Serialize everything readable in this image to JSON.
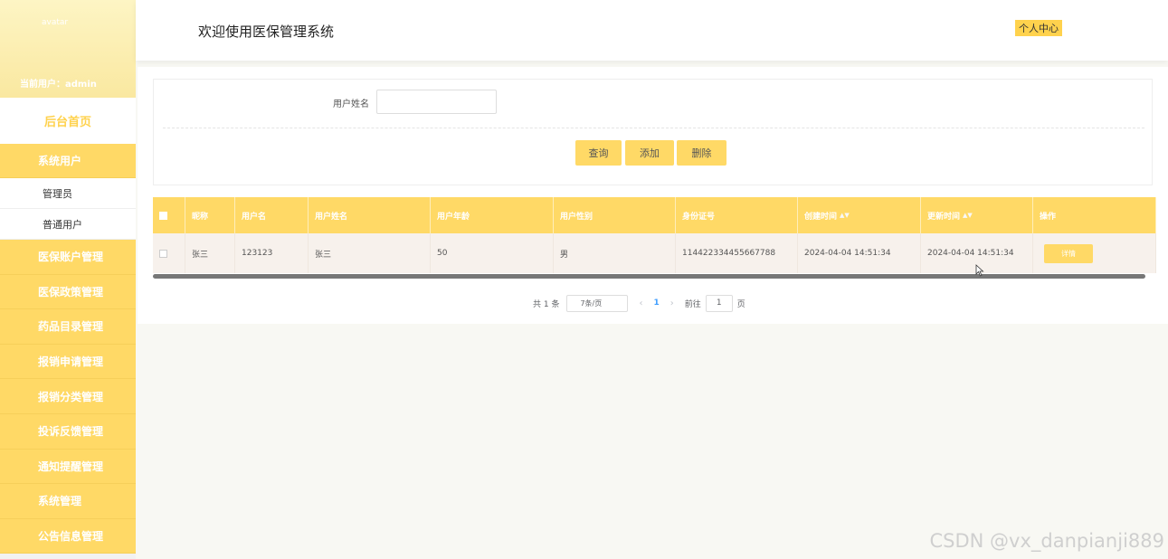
{
  "sidebar": {
    "avatar_alt": "avatar",
    "current_user": "当前用户：admin",
    "home": "后台首页",
    "items": [
      {
        "label": "系统用户"
      },
      {
        "label": "管理员",
        "sub": true
      },
      {
        "label": "普通用户",
        "sub": true
      },
      {
        "label": "医保账户管理"
      },
      {
        "label": "医保政策管理"
      },
      {
        "label": "药品目录管理"
      },
      {
        "label": "报销申请管理"
      },
      {
        "label": "报销分类管理"
      },
      {
        "label": "投诉反馈管理"
      },
      {
        "label": "通知提醒管理"
      },
      {
        "label": "系统管理"
      },
      {
        "label": "公告信息管理"
      }
    ]
  },
  "header": {
    "title": "欢迎使用医保管理系统",
    "personal_center": "个人中心"
  },
  "search": {
    "label": "用户姓名",
    "value": "",
    "query_btn": "查询",
    "add_btn": "添加",
    "delete_btn": "删除"
  },
  "table": {
    "columns": [
      "昵称",
      "用户名",
      "用户姓名",
      "用户年龄",
      "用户性别",
      "身份证号",
      "创建时间",
      "更新时间",
      "操作"
    ],
    "rows": [
      {
        "nickname": "张三",
        "username": "123123",
        "realname": "张三",
        "age": "50",
        "gender": "男",
        "id_card": "114422334455667788",
        "created": "2024-04-04 14:51:34",
        "updated": "2024-04-04 14:51:34",
        "action": "详情"
      }
    ]
  },
  "pagination": {
    "total": "共 1 条",
    "page_size": "7条/页",
    "current_page": "1",
    "goto_label": "前往",
    "goto_value": "1",
    "page_suffix": "页"
  },
  "watermark": "CSDN @vx_danpianji889",
  "colors": {
    "accent": "#ffd966",
    "accent_dark": "#ffd24d",
    "link": "#409eff"
  }
}
